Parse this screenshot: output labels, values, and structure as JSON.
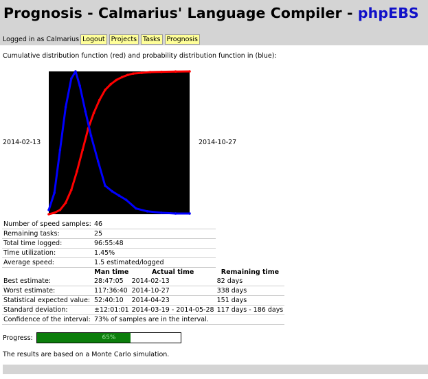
{
  "header": {
    "title_prefix": "Prognosis - Calmarius' Language Compiler - ",
    "brand": "phpEBS"
  },
  "nav": {
    "logged_in": "Logged in as Calmarius",
    "buttons": [
      "Logout",
      "Projects",
      "Tasks",
      "Prognosis"
    ]
  },
  "intro": "Cumulative distribution function (red) and probability distribution function in (blue):",
  "chart_data": {
    "type": "line",
    "title": "",
    "x_start_label": "2014-02-13",
    "x_end_label": "2014-10-27",
    "background": "#000000",
    "series": [
      {
        "name": "Cumulative distribution function",
        "color": "#ff0000",
        "x": [
          0,
          0.04,
          0.08,
          0.12,
          0.16,
          0.2,
          0.24,
          0.28,
          0.32,
          0.36,
          0.4,
          0.44,
          0.48,
          0.52,
          0.56,
          0.6,
          0.66,
          0.72,
          0.8,
          0.9,
          1
        ],
        "y": [
          0,
          0.01,
          0.03,
          0.08,
          0.17,
          0.3,
          0.45,
          0.6,
          0.71,
          0.8,
          0.87,
          0.91,
          0.94,
          0.96,
          0.975,
          0.985,
          0.99,
          0.995,
          0.997,
          0.999,
          1
        ]
      },
      {
        "name": "Probability distribution function",
        "color": "#0000ff",
        "x": [
          0,
          0.04,
          0.08,
          0.12,
          0.16,
          0.19,
          0.22,
          0.26,
          0.3,
          0.35,
          0.4,
          0.45,
          0.5,
          0.55,
          0.62,
          0.7,
          0.8,
          0.9,
          1
        ],
        "y": [
          0.03,
          0.15,
          0.45,
          0.75,
          0.95,
          1,
          0.9,
          0.72,
          0.55,
          0.37,
          0.2,
          0.16,
          0.13,
          0.1,
          0.04,
          0.02,
          0.01,
          0.005,
          0.005
        ]
      }
    ]
  },
  "stats": {
    "rows": [
      {
        "label": "Number of speed samples:",
        "value": "46"
      },
      {
        "label": "Remaining tasks:",
        "value": "25"
      },
      {
        "label": "Total time logged:",
        "value": "96:55:48"
      },
      {
        "label": "Time utilization:",
        "value": "1.45%"
      },
      {
        "label": "Average speed:",
        "value": "1.5 estimated/logged"
      }
    ],
    "estimate_headers": [
      "Man time",
      "Actual time",
      "Remaining time"
    ],
    "estimates": [
      {
        "label": "Best estimate:",
        "man": "28:47:05",
        "actual": "2014-02-13",
        "remaining": "82 days"
      },
      {
        "label": "Worst estimate:",
        "man": "117:36:40",
        "actual": "2014-10-27",
        "remaining": "338 days"
      },
      {
        "label": "Statistical expected value:",
        "man": "52:40:10",
        "actual": "2014-04-23",
        "remaining": "151 days"
      },
      {
        "label": "Standard deviation:",
        "man": "±12:01:01",
        "actual": "2014-03-19 - 2014-05-28",
        "remaining": "117 days - 186 days"
      }
    ],
    "confidence_label": "Confidence of the interval:",
    "confidence_value": "73% of samples are in the interval."
  },
  "progress": {
    "label": "Progress:",
    "text": "65%",
    "value": 0.65
  },
  "footer": "The results are based on a Monte Carlo simulation."
}
